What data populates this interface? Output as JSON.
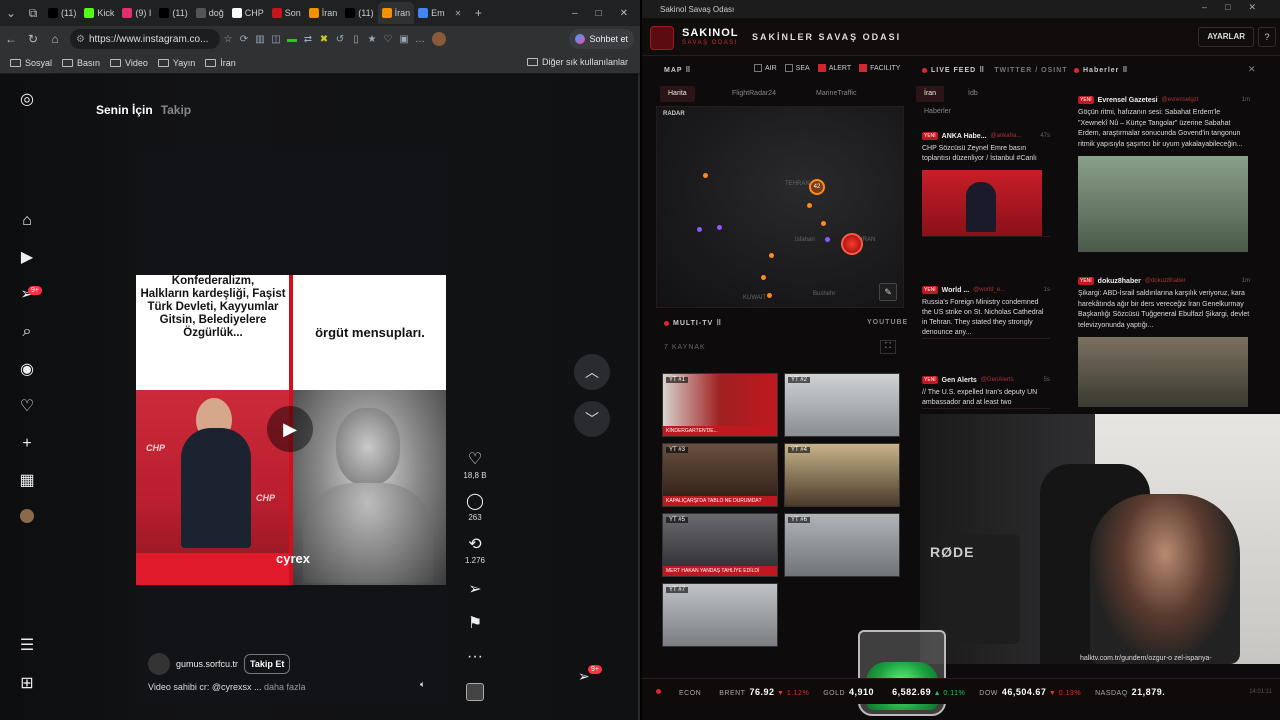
{
  "browser": {
    "tabs": [
      {
        "label": "(11)",
        "color": "#000000"
      },
      {
        "label": "Kick",
        "color": "#53fc18"
      },
      {
        "label": "(9) I",
        "color": "#e1306c"
      },
      {
        "label": "(11)",
        "color": "#000000"
      },
      {
        "label": "doğ",
        "color": "#555555"
      },
      {
        "label": "CHP",
        "color": "#ffffff"
      },
      {
        "label": "Son",
        "color": "#c4161c"
      },
      {
        "label": "İran",
        "color": "#f39200"
      },
      {
        "label": "(11)",
        "color": "#000000"
      },
      {
        "label": "İran",
        "color": "#f39200"
      },
      {
        "label": "Em",
        "color": "#4285f4"
      }
    ],
    "url": "https://www.instagram.co...",
    "chat_label": "Sohbet et",
    "bookmarks": [
      "Sosyal",
      "Basın",
      "Video",
      "Yayın",
      "İran"
    ],
    "bookmarks_other": "Diğer sık kullanılanlar"
  },
  "instagram": {
    "tab_for_you": "Senin İçin",
    "tab_following": "Takip",
    "notif_badge": "9+",
    "reel": {
      "text_left": "Halkların kardeşliği, Faşist Türk Devleti, Kayyumlar Gitsin, Belediyelere Özgürlük...",
      "text_left_top": "Konfederalizm,",
      "text_right": "örgüt mensupları.",
      "watermark": "cyrex",
      "chp": "CHP"
    },
    "likes": "18,8 B",
    "comments": "263",
    "reposts": "1.276",
    "author": "gumus.sorfcu.tr",
    "follow_label": "Takip Et",
    "caption": "Video sahibi cr: @cyrexsx ...",
    "more_label": "daha fazla",
    "messages_badge": "9+"
  },
  "dashboard": {
    "window_title": "Sakinol Savaş Odası",
    "brand": "SAKINOL",
    "brand_sub": "SAVAŞ ODASI",
    "hall": "SAKİNLER SAVAŞ ODASI",
    "settings_label": "AYARLAR",
    "help_label": "?",
    "map": {
      "title": "MAP",
      "filters": [
        {
          "label": "AIR",
          "on": false
        },
        {
          "label": "SEA",
          "on": false
        },
        {
          "label": "ALERT",
          "on": true
        },
        {
          "label": "FACILITY",
          "on": true
        }
      ],
      "tabs": [
        "Harita",
        "FlightRadar24",
        "MarineTraffic"
      ],
      "radar_label": "RADAR",
      "cluster_count": "42",
      "cities": [
        "TEHRAN",
        "IRAN",
        "KUWAIT",
        "Bushehr",
        "Isfahan"
      ]
    },
    "multitv": {
      "title": "MULTI-TV",
      "source": "YOUTUBE",
      "count": "7 KAYNAK",
      "channels": [
        "YT #1",
        "YT #2",
        "YT #3",
        "YT #4",
        "YT #5",
        "YT #6",
        "YT #7"
      ],
      "tickers": [
        "KİNDERGARTEN'DE...",
        "",
        "KAPALIÇARŞI'DA TABLO NE DURUMDA?",
        "",
        "MERT HAKAN YANDAŞ TAHLİYE EDİLDİ",
        "",
        ""
      ]
    },
    "livefeed": {
      "title": "LIVE FEED",
      "source": "TWITTER / OSINT",
      "tabs": [
        "İran",
        "İdb",
        "Haberler"
      ],
      "items": [
        {
          "tag": "YENİ",
          "source": "ANKA Habe...",
          "handle": "@ankaha...",
          "time": "47s",
          "text": "CHP Sözcüsü Zeynel Emre basın toplantısı düzenliyor / İstanbul #Canlı"
        },
        {
          "tag": "YENİ",
          "source": "World ...",
          "handle": "@world_e...",
          "time": "1s",
          "text": "Russia's Foreign Ministry condemned the US strike on St. Nicholas Cathedral in Tehran. They stated they strongly denounce any..."
        },
        {
          "tag": "YENİ",
          "source": "Gen Alerts",
          "handle": "@GenAlerts",
          "time": "5s",
          "text": "// The U.S. expelled Iran's deputy UN ambassador and at least two"
        }
      ]
    },
    "news": {
      "title": "Haberler",
      "items": [
        {
          "tag": "YENİ",
          "source": "Evrensel Gazetesi",
          "handle": "@evrenselgzt",
          "time": "1m",
          "text": "Göçün ritmi, hafızanın sesi: Sabahat Erdem'le \"Xewnekî Nû – Kürtçe Tangolar\" üzerine Sabahat Erdem, araştırmalar sonucunda Govend'in tangonun ritmik yapısıyla şaşırtıcı bir uyum yakalayabileceğin..."
        },
        {
          "tag": "YENİ",
          "source": "dokuz8haber",
          "handle": "@dokuz8haber",
          "time": "1m",
          "text": "Şikargi: ABD-İsrail saldırılarına karşılık veriyoruz, kara harekâtında ağır bir ders vereceğiz İran Genelkurmay Başkanlığı Sözcüsü Tuğgeneral Ebulfazl Şikargi, devlet televizyonunda yaptığı..."
        }
      ]
    },
    "ticker": [
      {
        "label": "ECON",
        "value": "",
        "change": "",
        "dir": ""
      },
      {
        "label": "BRENT",
        "value": "76.92",
        "change": "▼ 1.12%",
        "dir": "dn"
      },
      {
        "label": "GOLD",
        "value": "4,910",
        "change": "",
        "dir": ""
      },
      {
        "label": "",
        "value": "6,582.69",
        "change": "▲ 0.11%",
        "dir": "up"
      },
      {
        "label": "DOW",
        "value": "46,504.67",
        "change": "▼ 0.13%",
        "dir": "dn"
      },
      {
        "label": "NASDAQ",
        "value": "21,879.",
        "change": "",
        "dir": ""
      }
    ],
    "clock": "14:01:11"
  },
  "webcam": {
    "mic_brand": "RØDE",
    "overlay_url": "halktv.com.tr/gundem/ozgur-o zel-ispanya-"
  }
}
